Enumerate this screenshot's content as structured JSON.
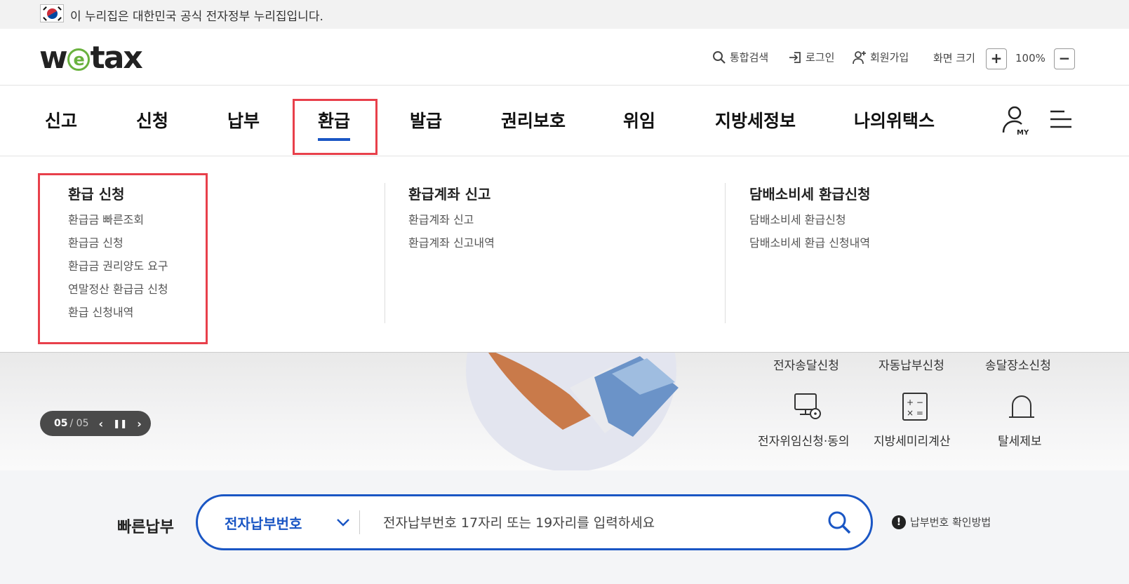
{
  "gov_banner": {
    "text": "이 누리집은 대한민국 공식 전자정부 누리집입니다."
  },
  "header": {
    "logo_pre": "w",
    "logo_mid": "e",
    "logo_post": "tax",
    "util": {
      "search": "통합검색",
      "login": "로그인",
      "signup": "회원가입",
      "zoom_label": "화면 크기",
      "zoom_in": "+",
      "zoom_value": "100%",
      "zoom_out": "−"
    }
  },
  "nav": {
    "items": [
      "신고",
      "신청",
      "납부",
      "환급",
      "발급",
      "권리보호",
      "위임",
      "지방세정보",
      "나의위택스"
    ],
    "active": "환급"
  },
  "dropdown": {
    "columns": [
      {
        "title": "환급 신청",
        "links": [
          "환급금 빠른조회",
          "환급금 신청",
          "환급금 권리양도 요구",
          "연말정산 환급금 신청",
          "환급 신청내역"
        ]
      },
      {
        "title": "환급계좌 신고",
        "links": [
          "환급계좌 신고",
          "환급계좌 신고내역"
        ]
      },
      {
        "title": "담배소비세 환급신청",
        "links": [
          "담배소비세 환급신청",
          "담배소비세 환급 신청내역"
        ]
      }
    ]
  },
  "hero": {
    "slider": {
      "current": "05",
      "total": "05",
      "prev": "‹",
      "pause": "❚❚",
      "next": "›"
    },
    "quick_top": [
      "전자송달신청",
      "자동납부신청",
      "송달장소신청"
    ],
    "quick_bottom": [
      "전자위임신청·동의",
      "지방세미리계산",
      "탈세제보"
    ]
  },
  "quick_pay": {
    "title": "빠른납부",
    "select_value": "전자납부번호",
    "placeholder": "전자납부번호 17자리 또는 19자리를 입력하세요",
    "help": "납부번호 확인방법",
    "help_mark": "!"
  },
  "colors": {
    "accent": "#1a56c4",
    "highlight": "#e8404b",
    "logo_green": "#6ab23e"
  }
}
